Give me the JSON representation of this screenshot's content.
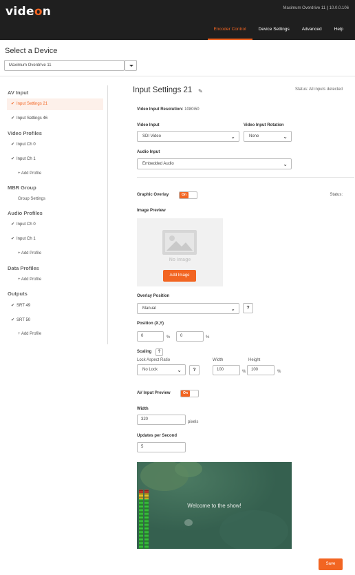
{
  "header": {
    "logo": {
      "pre": "vide",
      "o": "o",
      "post": "n"
    },
    "device_name": "Maximum Overdrive 11",
    "ip": "10.0.0.106",
    "nav": [
      "Encoder Control",
      "Device Settings",
      "Advanced",
      "Help"
    ],
    "active_nav": "Encoder Control",
    "accent_color": "#f26522"
  },
  "device_picker": {
    "title": "Select a Device",
    "selected": "Maximum Overdrive 11"
  },
  "sidebar": {
    "av_input": {
      "heading": "AV Input",
      "items": [
        "Input Settings 21",
        "Input Settings 46"
      ]
    },
    "video_profiles": {
      "heading": "Video Profiles",
      "items": [
        "Input Ch 0",
        "Input Ch 1"
      ],
      "add": "+ Add Profile"
    },
    "mbr_group": {
      "heading": "MBR Group",
      "item": "Group Settings"
    },
    "audio_profiles": {
      "heading": "Audio Profiles",
      "items": [
        "Input Ch 0",
        "Input Ch 1"
      ],
      "add": "+ Add Profile"
    },
    "data_profiles": {
      "heading": "Data Profiles",
      "add": "+ Add Profile"
    },
    "outputs": {
      "heading": "Outputs",
      "items": [
        "SRT 49",
        "SRT 50"
      ],
      "add": "+ Add Profile"
    }
  },
  "main": {
    "title": "Input Settings 21",
    "status": "Status: All inputs detected",
    "resolution_label": "Video Input Resolution:",
    "resolution_value": "1080i50",
    "video_input": {
      "label": "Video Input",
      "value": "SDI Video"
    },
    "rotation": {
      "label": "Video Input Rotation",
      "value": "None"
    },
    "audio_input": {
      "label": "Audio Input",
      "value": "Embedded Audio"
    },
    "graphic_overlay": {
      "label": "Graphic Overlay",
      "toggle": "On",
      "status": "Status:"
    },
    "image_preview": {
      "label": "Image Preview",
      "placeholder": "No image",
      "button": "Add Image"
    },
    "overlay_position": {
      "label": "Overlay Position",
      "value": "Manual",
      "help": "?"
    },
    "position": {
      "label": "Position (X,Y)",
      "x": "0",
      "y": "0",
      "unit": "%"
    },
    "scaling": {
      "label": "Scaling",
      "help": "?",
      "aspect_label": "Lock Aspect Ratio",
      "aspect_value": "No Lock",
      "width_label": "Width",
      "width": "100",
      "height_label": "Height",
      "height": "100",
      "unit": "%"
    },
    "av_preview": {
      "label": "AV Input Preview",
      "toggle": "On"
    },
    "width": {
      "label": "Width",
      "value": "320",
      "unit": "pixels"
    },
    "updates": {
      "label": "Updates per Second",
      "value": "5"
    },
    "preview_caption": "Welcome to the show!",
    "save": "Save"
  }
}
